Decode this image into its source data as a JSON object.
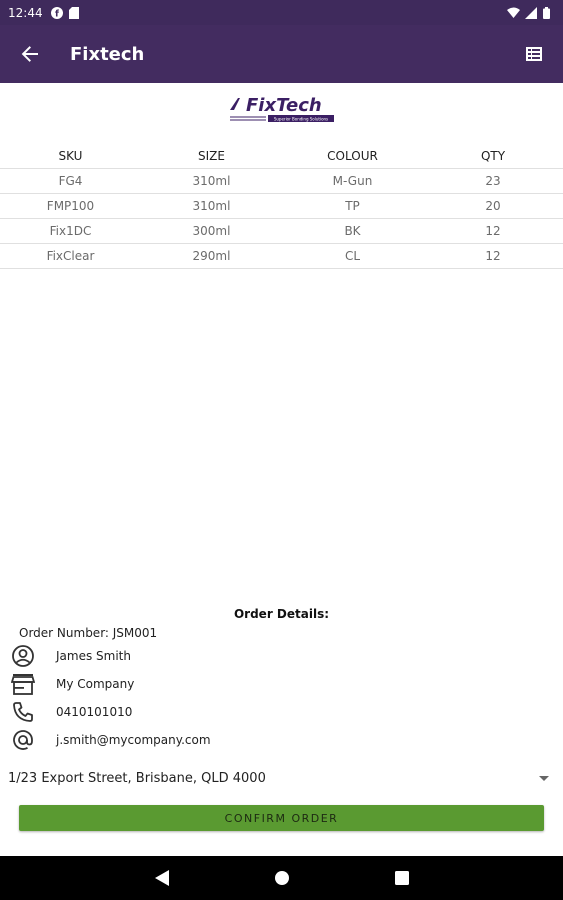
{
  "status_bar": {
    "time": "12:44",
    "icons": [
      "f-icon",
      "sd-card-icon",
      "wifi-icon",
      "signal-icon",
      "battery-icon"
    ]
  },
  "app_bar": {
    "title": "Fixtech",
    "back_icon": "arrow-back-icon",
    "action_icon": "table-view-icon"
  },
  "logo": {
    "text": "FixTech",
    "tagline": "Superior Bonding Solutions",
    "color": "#3b1f64"
  },
  "table": {
    "columns": [
      "SKU",
      "SIZE",
      "COLOUR",
      "QTY"
    ],
    "rows": [
      {
        "sku": "FG4",
        "size": "310ml",
        "colour": "M-Gun",
        "qty": "23"
      },
      {
        "sku": "FMP100",
        "size": "310ml",
        "colour": "TP",
        "qty": "20"
      },
      {
        "sku": "Fix1DC",
        "size": "300ml",
        "colour": "BK",
        "qty": "12"
      },
      {
        "sku": "FixClear",
        "size": "290ml",
        "colour": "CL",
        "qty": "12"
      }
    ]
  },
  "order_details": {
    "heading": "Order Details:",
    "order_number": "Order Number: JSM001",
    "name": "James Smith",
    "company": "My Company",
    "phone": "0410101010",
    "email": "j.smith@mycompany.com"
  },
  "address": {
    "selected": "1/23 Export Street, Brisbane, QLD 4000"
  },
  "confirm_button": {
    "label": "CONFIRM ORDER",
    "color": "#5a9a31"
  },
  "colors": {
    "primary": "#432c60",
    "status_bar": "#3f2a5c"
  }
}
